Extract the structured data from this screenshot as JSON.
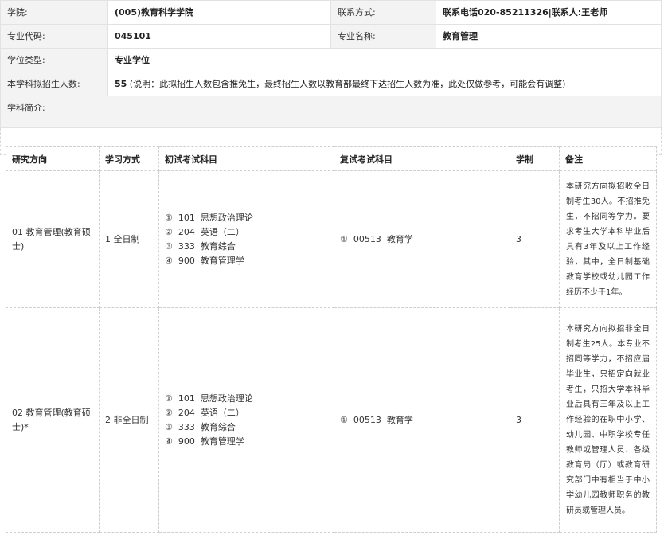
{
  "info": {
    "college_label": "学院:",
    "college_value": "(005)教育科学学院",
    "contact_label": "联系方式:",
    "contact_value": "联系电话020-85211326|联系人:王老师",
    "major_code_label": "专业代码:",
    "major_code_value": "045101",
    "major_name_label": "专业名称:",
    "major_name_value": "教育管理",
    "degree_type_label": "学位类型:",
    "degree_type_value": "专业学位",
    "enroll_label": "本学科拟招生人数:",
    "enroll_number": "55",
    "enroll_note": " (说明：此拟招生人数包含推免生，最终招生人数以教育部最终下达招生人数为准，此处仅做参考，可能会有调整)",
    "intro_label": "学科简介:"
  },
  "table": {
    "headers": [
      "研究方向",
      "学习方式",
      "初试考试科目",
      "复试考试科目",
      "学制",
      "备注"
    ],
    "rows": [
      {
        "direction": "01 教育管理(教育硕士)",
        "mode": "1 全日制",
        "subjects": [
          "①  101  思想政治理论",
          "②  204  英语（二）",
          "③  333  教育综合",
          "④  900  教育管理学"
        ],
        "retest": "①  00513  教育学",
        "years": "3",
        "remark": "本研究方向拟招收全日制考生30人。不招推免生，不招同等学力。要求考生大学本科毕业后具有3年及以上工作经验，其中，全日制基础教育学校或幼儿园工作经历不少于1年。"
      },
      {
        "direction": "02 教育管理(教育硕士)*",
        "mode": "2 非全日制",
        "subjects": [
          "①  101  思想政治理论",
          "②  204  英语（二）",
          "③  333  教育综合",
          "④  900  教育管理学"
        ],
        "retest": "①  00513  教育学",
        "years": "3",
        "remark": "本研究方向拟招非全日制考生25人。本专业不招同等学力，不招应届毕业生，只招定向就业考生，只招大学本科毕业后具有三年及以上工作经验的在职中小学、幼儿园、中职学校专任教师或管理人员、各级教育局（厅）或教育研究部门中有相当于中小学幼儿园教师职务的教研员或管理人员。"
      }
    ]
  }
}
